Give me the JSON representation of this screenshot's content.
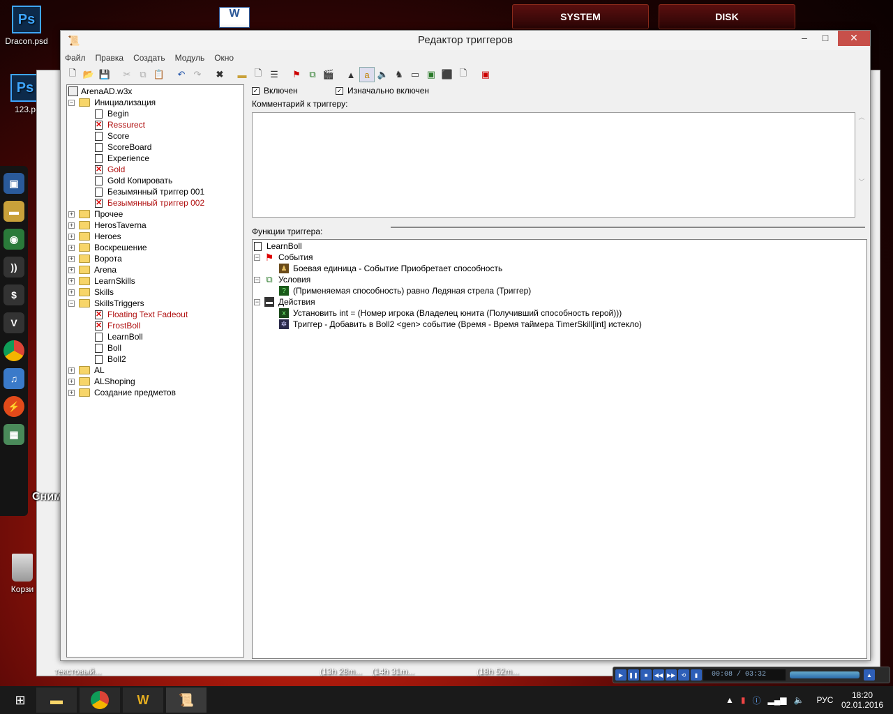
{
  "desktop": {
    "icons": [
      {
        "label": "Dracon.psd",
        "icon": "photoshop-icon"
      },
      {
        "label": "123.p",
        "icon": "photoshop-icon"
      },
      {
        "label": "Корзи",
        "icon": "recycle-bin-icon"
      }
    ],
    "top_buttons": [
      "SYSTEM",
      "DISK"
    ],
    "dock_tooltip": "Снимок экрана",
    "background_labels": [
      "текстовый...",
      "(13h 28m...",
      "(14h 31m...",
      "(18h 52m..."
    ]
  },
  "window": {
    "title": "Редактор триггеров",
    "controls": {
      "minimize": "–",
      "maximize": "□",
      "close": "✕"
    },
    "menu": [
      "Файл",
      "Правка",
      "Создать",
      "Модуль",
      "Окно"
    ]
  },
  "tree": {
    "root": "ArenaAD.w3x",
    "items": [
      {
        "label": "Инициализация",
        "type": "folder",
        "expanded": true,
        "level": 1
      },
      {
        "label": "Begin",
        "type": "trigger",
        "disabled": false,
        "level": 2
      },
      {
        "label": "Ressurect",
        "type": "trigger",
        "disabled": true,
        "level": 2
      },
      {
        "label": "Score",
        "type": "trigger",
        "disabled": false,
        "level": 2
      },
      {
        "label": "ScoreBoard",
        "type": "trigger",
        "disabled": false,
        "level": 2
      },
      {
        "label": "Experience",
        "type": "trigger",
        "disabled": false,
        "level": 2
      },
      {
        "label": "Gold",
        "type": "trigger",
        "disabled": true,
        "level": 2
      },
      {
        "label": "Gold Копировать",
        "type": "trigger",
        "disabled": false,
        "level": 2
      },
      {
        "label": "Безымянный триггер 001",
        "type": "trigger",
        "disabled": false,
        "level": 2
      },
      {
        "label": "Безымянный триггер 002",
        "type": "trigger",
        "disabled": true,
        "level": 2
      },
      {
        "label": "Прочее",
        "type": "folder",
        "expanded": false,
        "level": 1
      },
      {
        "label": "HerosTaverna",
        "type": "folder",
        "expanded": false,
        "level": 1
      },
      {
        "label": "Heroes",
        "type": "folder",
        "expanded": false,
        "level": 1
      },
      {
        "label": "Воскрешение",
        "type": "folder",
        "expanded": false,
        "level": 1
      },
      {
        "label": "Ворота",
        "type": "folder",
        "expanded": false,
        "level": 1
      },
      {
        "label": "Arena",
        "type": "folder",
        "expanded": false,
        "level": 1
      },
      {
        "label": "LearnSkills",
        "type": "folder",
        "expanded": false,
        "level": 1
      },
      {
        "label": "Skills",
        "type": "folder",
        "expanded": false,
        "level": 1
      },
      {
        "label": "SkillsTriggers",
        "type": "folder",
        "expanded": true,
        "level": 1
      },
      {
        "label": "Floating Text Fadeout",
        "type": "trigger",
        "disabled": true,
        "level": 2
      },
      {
        "label": "FrostBoll",
        "type": "trigger",
        "disabled": true,
        "level": 2
      },
      {
        "label": "LearnBoll",
        "type": "trigger",
        "disabled": false,
        "level": 2
      },
      {
        "label": "Boll",
        "type": "trigger",
        "disabled": false,
        "level": 2
      },
      {
        "label": "Boll2",
        "type": "trigger",
        "disabled": false,
        "level": 2
      },
      {
        "label": "AL",
        "type": "folder",
        "expanded": false,
        "level": 1
      },
      {
        "label": "ALShoping",
        "type": "folder",
        "expanded": false,
        "level": 1
      },
      {
        "label": "Создание предметов",
        "type": "folder",
        "expanded": false,
        "level": 1
      }
    ]
  },
  "trigger": {
    "enabled_label": "Включен",
    "initially_enabled_label": "Изначально включен",
    "comment_label": "Комментарий к триггеру:",
    "functions_label": "Функции триггера:",
    "functions": {
      "name": "LearnBoll",
      "events_label": "События",
      "event": "Боевая единица - Событие Приобретает способность",
      "conditions_label": "Условия",
      "condition": "(Применяемая способность) равно Ледяная стрела (Триггер)",
      "actions_label": "Действия",
      "actions": [
        "Установить int = (Номер игрока (Владелец юнита (Получивший способность герой)))",
        "Триггер - Добавить в Boll2 <gen> событие (Время - Время таймера TimerSkill[int] истекло)"
      ]
    }
  },
  "media_player": {
    "time": "00:08 / 03:32"
  },
  "taskbar": {
    "language": "РУС",
    "time": "18:20",
    "date": "02.01.2016"
  }
}
